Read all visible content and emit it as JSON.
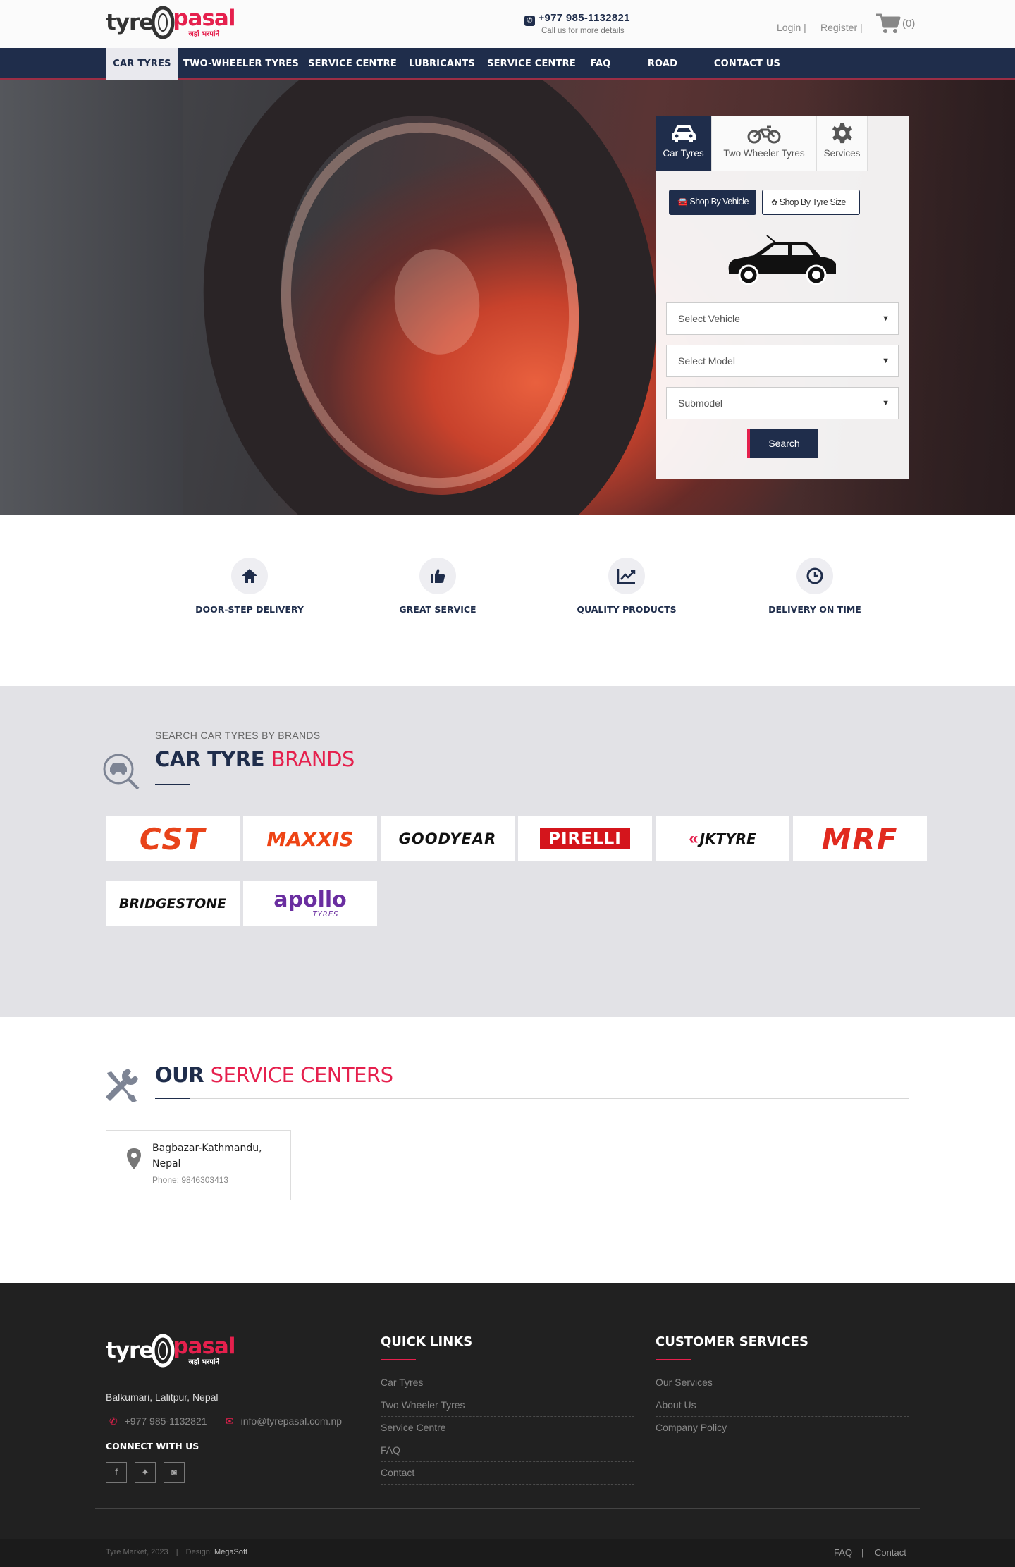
{
  "header": {
    "logo_word_a": "tyre",
    "logo_word_b": "pasal",
    "logo_tagline": "जहाँ भरपर्नि",
    "phone": "+977 985-1132821",
    "phone_sub": "Call us for more details",
    "login": "Login",
    "register": "Register",
    "separator": "|",
    "cart_count": "(0)"
  },
  "nav": {
    "items": [
      {
        "label": "CAR TYRES"
      },
      {
        "label": "TWO-WHEELER TYRES"
      },
      {
        "label": "SERVICE CENTRE"
      },
      {
        "label": "LUBRICANTS"
      },
      {
        "label": "SERVICE CENTRE"
      },
      {
        "label": "FAQ"
      },
      {
        "label": "ROAD TALES"
      },
      {
        "label": "CONTACT US"
      }
    ],
    "active_index": 0
  },
  "finder": {
    "tabs": [
      {
        "label": "Car Tyres",
        "icon": "car-icon"
      },
      {
        "label": "Two Wheeler Tyres",
        "icon": "motorcycle-icon"
      },
      {
        "label": "Services",
        "icon": "gear-icon"
      }
    ],
    "shop_by_vehicle": "Shop By Vehicle",
    "shop_by_size": "Shop By Tyre Size",
    "select_vehicle": "Select Vehicle",
    "select_model": "Select Model",
    "select_submodel": "Submodel",
    "search": "Search"
  },
  "features": [
    {
      "label": "DOOR-STEP DELIVERY",
      "icon": "home-icon"
    },
    {
      "label": "GREAT SERVICE",
      "icon": "thumbs-up-icon"
    },
    {
      "label": "QUALITY PRODUCTS",
      "icon": "chart-icon"
    },
    {
      "label": "DELIVERY ON TIME",
      "icon": "clock-icon"
    }
  ],
  "brands_section": {
    "subtitle": "SEARCH CAR TYRES BY BRANDS",
    "title_a": "CAR TYRE",
    "title_b": "BRANDS",
    "brands": [
      {
        "name": "CST",
        "color": "#e8431a"
      },
      {
        "name": "MAXXIS",
        "color": "#ee4415"
      },
      {
        "name": "GOODYEAR",
        "color": "#111111"
      },
      {
        "name": "PIRELLI",
        "color": "#d4151c"
      },
      {
        "name": "JKTYRE",
        "color": "#111111"
      },
      {
        "name": "MRF",
        "color": "#e12a1f"
      },
      {
        "name": "BRIDGESTONE",
        "color": "#111111"
      },
      {
        "name": "apollo",
        "color": "#6a2ea0",
        "sub": "TYRES"
      }
    ]
  },
  "service_section": {
    "title_a": "OUR",
    "title_b": "SERVICE CENTERS",
    "centers": [
      {
        "name": "Bagbazar-Kathmandu, Nepal",
        "phone": "Phone: 9846303413"
      }
    ]
  },
  "footer": {
    "address": "Balkumari, Lalitpur, Nepal",
    "phone": "+977 985-1132821",
    "email": "info@tyrepasal.com.np",
    "connect": "CONNECT WITH US",
    "quick_links_title": "QUICK LINKS",
    "quick_links": [
      "Car Tyres",
      "Two Wheeler Tyres",
      "Service Centre",
      "FAQ",
      "Contact"
    ],
    "customer_title": "CUSTOMER SERVICES",
    "customer_links": [
      "Our Services",
      "About Us",
      "Company Policy"
    ],
    "copyright": "Tyre Market, 2023",
    "design_label": "Design:",
    "design_by": "MegaSoft",
    "bottom_faq": "FAQ",
    "bottom_contact": "Contact"
  },
  "colors": {
    "navy": "#1f2d4b",
    "accent": "#e5204d",
    "footer_bg": "#212121"
  }
}
